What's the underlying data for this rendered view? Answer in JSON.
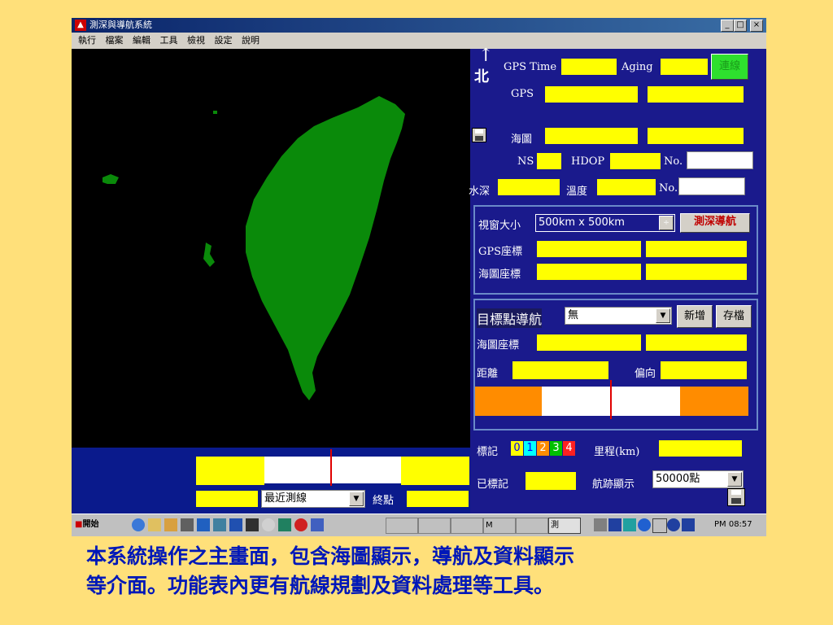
{
  "window": {
    "title": "測深與導航系統",
    "minimize": "_",
    "maximize": "□",
    "close": "×"
  },
  "menu": [
    "執行",
    "檔案",
    "編輯",
    "工具",
    "檢視",
    "設定",
    "說明"
  ],
  "north": {
    "arrow": "↑",
    "label": "北"
  },
  "status": {
    "gps_time_label": "GPS Time",
    "aging_label": "Aging",
    "connect_button": "連線",
    "gps_label": "GPS",
    "chart_label": "海圖",
    "ns_label": "NS",
    "hdop_label": "HDOP",
    "no_label": "No.",
    "depth_label": "水深",
    "temp_label": "溫度",
    "no2_label": "No."
  },
  "view": {
    "size_label": "視窗大小",
    "size_value": "500km x 500km",
    "nav_button": "測深導航",
    "gps_coord_label": "GPS座標",
    "chart_coord_label": "海圖座標"
  },
  "target": {
    "label": "目標點導航",
    "select_value": "無",
    "add_button": "新增",
    "save_button": "存檔",
    "chart_coord_label": "海圖座標",
    "distance_label": "距離",
    "offset_label": "偏向"
  },
  "marks": {
    "label": "標記",
    "items": [
      {
        "text": "0",
        "color": "#ffff00",
        "fg": "#0000ff"
      },
      {
        "text": "1",
        "color": "#00ffff",
        "fg": "#0000ff"
      },
      {
        "text": "2",
        "color": "#ff8c00",
        "fg": "#ffffff"
      },
      {
        "text": "3",
        "color": "#00c000",
        "fg": "#ffffff"
      },
      {
        "text": "4",
        "color": "#ff2020",
        "fg": "#ffffff"
      }
    ],
    "mileage_label": "里程(km)",
    "marked_label": "已標記",
    "track_label": "航跡顯示",
    "track_value": "50000點"
  },
  "route": {
    "select_value": "最近測線",
    "end_label": "終點"
  },
  "taskbar": {
    "start": "開始",
    "tasks": [
      "",
      "",
      "",
      "M",
      "",
      "測"
    ],
    "clock": "PM 08:57"
  },
  "caption": {
    "line1": "本系統操作之主畫面，包含海圖顯示，導航及資料顯示",
    "line2": "等介面。功能表內更有航線規劃及資料處理等工具。"
  },
  "colors": {
    "land": "#0a8a0a",
    "panel": "#1a1a8c",
    "field": "#ffff00",
    "connect": "#2ee02e",
    "bar_orange": "#ff8c00"
  }
}
